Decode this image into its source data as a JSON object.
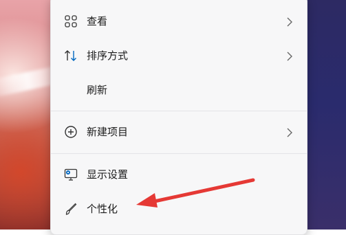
{
  "context_menu": {
    "items": [
      {
        "label": "查看",
        "icon": "grid-icon",
        "has_submenu": true
      },
      {
        "label": "排序方式",
        "icon": "sort-icon",
        "has_submenu": true
      },
      {
        "label": "刷新",
        "icon": "",
        "has_submenu": false
      },
      {
        "label": "新建项目",
        "icon": "plus-circle-icon",
        "has_submenu": true
      },
      {
        "label": "显示设置",
        "icon": "display-settings-icon",
        "has_submenu": false
      },
      {
        "label": "个性化",
        "icon": "brush-icon",
        "has_submenu": false
      }
    ]
  },
  "annotation": {
    "arrow_color": "#e53935"
  },
  "colors": {
    "menu_background": "#f7f7f8",
    "text": "#1b1b1b",
    "accent": "#0067c0"
  }
}
